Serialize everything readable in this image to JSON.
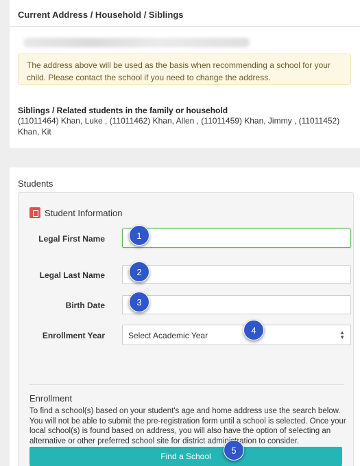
{
  "address_panel": {
    "title": "Current Address / Household / Siblings",
    "alert": "The address above will be used as the basis when recommending a school for your child. Please contact the school if you need to change the address.",
    "siblings_heading": "Siblings / Related students in the family or household",
    "siblings_text": "(11011464) Khan, Luke , (11011462) Khan, Allen , (11011459) Khan, Jimmy , (11011452) Khan, Kit"
  },
  "students_panel": {
    "title": "Students",
    "section_title": "Student Information",
    "fields": {
      "first_name_label": "Legal First Name",
      "last_name_label": "Legal Last Name",
      "birth_date_label": "Birth Date",
      "enrollment_year_label": "Enrollment Year",
      "enrollment_year_value": "Select Academic Year"
    },
    "enrollment_title": "Enrollment",
    "enrollment_text": "To find a school(s) based on your student's age and home address use the search below. You will not be able to submit the pre-registration form until a school is selected. Once your local school(s) is found based on address, you will also have the option of selecting an alternative or other preferred school site for district administration to consider.",
    "find_button": "Find a School"
  },
  "steps": [
    "1",
    "2",
    "3",
    "4",
    "5"
  ],
  "colors": {
    "alert_bg": "#fcf8e3",
    "focus_border": "#5cb85c",
    "step_badge": "#2f57c9",
    "button": "#26b5b5",
    "icon_red": "#d9534f"
  },
  "icons": [
    "pdf-icon",
    "select-arrows-icon"
  ]
}
